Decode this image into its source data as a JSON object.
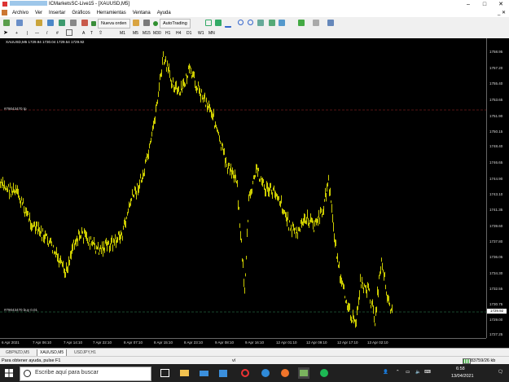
{
  "window": {
    "title_visible": "ICMarketsSC-Live15 - [XAUUSD,M5]",
    "buttons": [
      "–",
      "□",
      "✕"
    ]
  },
  "menu": {
    "items": [
      "Archivo",
      "Ver",
      "Insertar",
      "Gráficos",
      "Herramientas",
      "Ventana",
      "Ayuda"
    ],
    "close": "_ ✕"
  },
  "toolbar": {
    "new_order": "Nueva orden",
    "autotrading": "AutoTrading",
    "notification_count": "1",
    "timeframes": [
      "M1",
      "M5",
      "M15",
      "M30",
      "H1",
      "H4",
      "D1",
      "W1",
      "MN"
    ],
    "drawing_tools": [
      "+",
      "|",
      "—",
      "/",
      "#",
      "A",
      "T"
    ]
  },
  "chart": {
    "symbol_label": "XAUUSD,M5  1729.94  1730.04  1729.54  1729.92",
    "tp_label": "#79043470 tp",
    "buy_label": "#79043470 buy 0.01",
    "current_price": "1729.92",
    "colors": {
      "background": "#000000",
      "bars": "#ffff00",
      "tp_line": "#a52a2a",
      "buy_line": "#2e8b57"
    }
  },
  "price_scale": [
    "1758.95",
    "1757.20",
    "1755.40",
    "1753.65",
    "1751.90",
    "1750.15",
    "1748.40",
    "1746.65",
    "1744.90",
    "1743.10",
    "1741.35",
    "1739.60",
    "1737.80",
    "1736.05",
    "1734.30",
    "1732.55",
    "1730.75",
    "1729.00",
    "1727.25"
  ],
  "time_axis": [
    "6 Apr 2021",
    "7 Apr 06:10",
    "7 Apr 14:10",
    "7 Apr 22:10",
    "8 Apr 07:10",
    "8 Apr 15:10",
    "8 Apr 23:10",
    "9 Apr 08:10",
    "9 Apr 16:10",
    "12 Apr 01:10",
    "12 Apr 09:10",
    "12 Apr 17:10",
    "13 Apr 02:10"
  ],
  "chart_tabs": [
    "GBPNZD,M5",
    "XAUUSD,M5",
    "USDJPY,H1"
  ],
  "status": {
    "help": "Para obtener ayuda, pulse F1",
    "middle": "ví",
    "traffic": "83759/26 kb"
  },
  "taskbar": {
    "search_placeholder": "Escribe aquí para buscar",
    "time": "6:58",
    "date": "13/04/2021"
  }
}
